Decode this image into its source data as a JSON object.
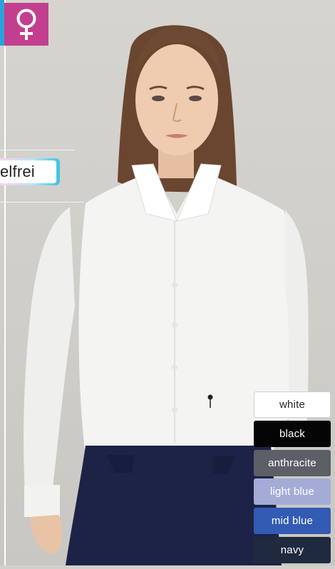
{
  "badge": {
    "icon": "female-symbol-icon",
    "color": "#c23f8f"
  },
  "feature_tag": {
    "label": "elfrei"
  },
  "colors": [
    {
      "label": "white",
      "bg": "#ffffff",
      "fg": "#222222"
    },
    {
      "label": "black",
      "bg": "#050505",
      "fg": "#ffffff"
    },
    {
      "label": "anthracite",
      "bg": "#5c5f66",
      "fg": "#ffffff"
    },
    {
      "label": "light blue",
      "bg": "#a4acd6",
      "fg": "#ffffff"
    },
    {
      "label": "mid blue",
      "bg": "#335bb4",
      "fg": "#ffffff"
    },
    {
      "label": "navy",
      "bg": "#1f2a3e",
      "fg": "#ffffff"
    }
  ]
}
